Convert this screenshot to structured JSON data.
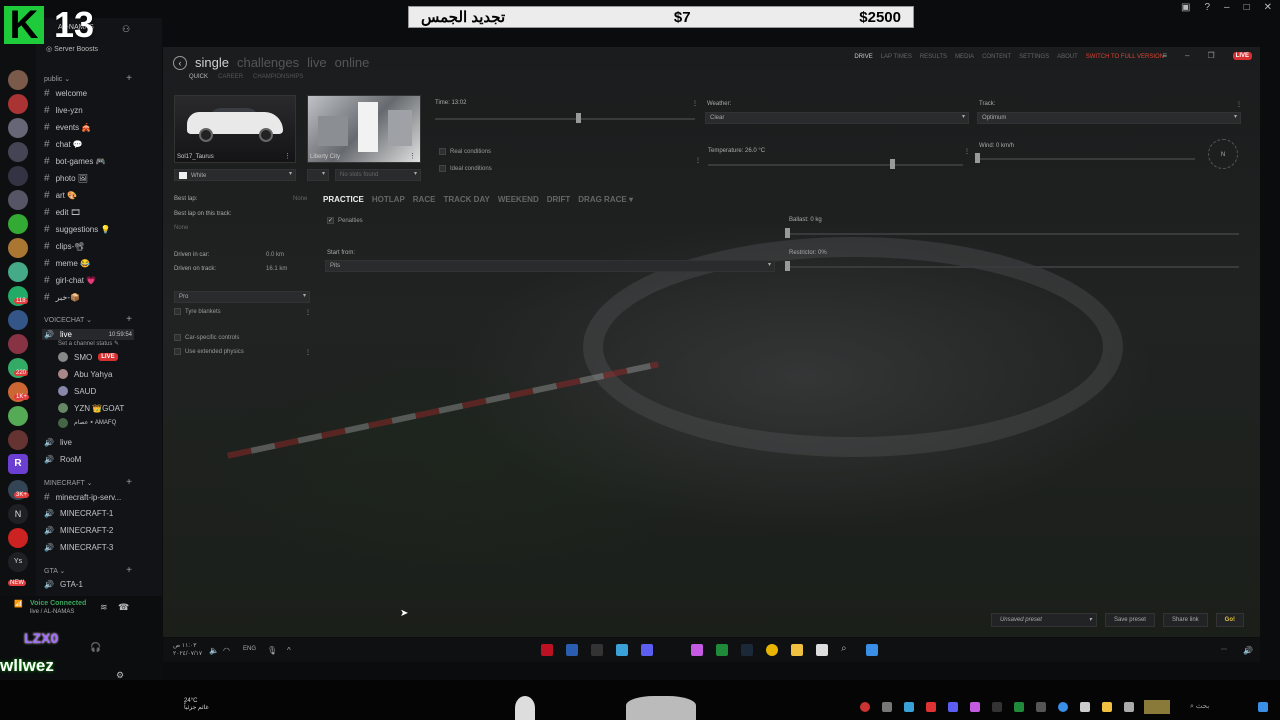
{
  "overlay": {
    "k_letter": "K",
    "number": "13",
    "banner": {
      "left": "تجديد الجمس",
      "mid": "$7",
      "right": "$2500"
    }
  },
  "discord": {
    "server_name": "AL-NAMAS",
    "server_boosts": "Server Boosts",
    "categories": {
      "public": "public",
      "voicechat": "VOICECHAT",
      "minecraft": "MINECRAFT",
      "gta": "GTA"
    },
    "text_channels": [
      "welcome",
      "live-yzn",
      "events 🎪",
      "chat 💬",
      "bot-games 🎮",
      "photo 🖼",
      "art 🎨",
      "edit 🎞",
      "suggestions 💡",
      "clips-📽",
      "meme 😂",
      "girl-chat 💗",
      "خبر-📦"
    ],
    "voice": {
      "live_channel": "live",
      "live_time": "10:59:54",
      "set_status": "Set a channel status ✎",
      "members": [
        {
          "name": "SMO",
          "badge": "LIVE"
        },
        {
          "name": "Abu Yahya",
          "badge": ""
        },
        {
          "name": "SAUD",
          "badge": ""
        },
        {
          "name": "YZN 👑GOAT",
          "badge": ""
        },
        {
          "name": "عصام ⭑ AMAFQ",
          "badge": ""
        }
      ],
      "other_channels": [
        "live",
        "RooM"
      ]
    },
    "minecraft_channels": [
      "minecraft-ip-serv...",
      "MINECRAFT-1",
      "MINECRAFT-2",
      "MINECRAFT-3"
    ],
    "gta_channels": [
      "GTA-1"
    ],
    "voice_connected": "Voice Connected",
    "voice_sub": "live / AL-NAMAS",
    "users": [
      "LZX0",
      "wllwez",
      "wllwez"
    ],
    "server_badges": [
      "118",
      "3K+",
      "220",
      "1K+",
      "NEW"
    ],
    "server_letters": [
      "R",
      "N",
      "Ys"
    ]
  },
  "game": {
    "modes": [
      "single",
      "challenges",
      "live",
      "online"
    ],
    "active_mode": "single",
    "sub_modes": [
      "QUICK",
      "CAREER",
      "CHAMPIONSHIPS"
    ],
    "top_nav": [
      "DRIVE",
      "LAP TIMES",
      "RESULTS",
      "MEDIA",
      "CONTENT",
      "SETTINGS",
      "ABOUT",
      "SWITCH TO FULL VERSION"
    ],
    "live_badge": "LIVE",
    "car_name": "Sol17_Taurus",
    "car_skin": "White",
    "track_name": "Liberty City",
    "track_layout": "No slots found",
    "time_label": "Time: 13:02",
    "time_level": 0.55,
    "weather_label": "Weather:",
    "weather_value": "Clear",
    "track_label": "Track:",
    "track_value": "Optimum",
    "real_conditions": "Real conditions",
    "ideal_conditions": "Ideal conditions",
    "temperature_label": "Temperature: 26.0 °C",
    "temperature_level": 0.72,
    "wind_label": "Wind: 0 km/h",
    "wind_dir": "N",
    "best_lap_label": "Best lap:",
    "best_lap_value": "None",
    "best_lap_track_label": "Best lap on this track:",
    "best_lap_track_value": "None",
    "driven_car_label": "Driven in car:",
    "driven_car_value": "0.0 km",
    "driven_track_label": "Driven on track:",
    "driven_track_value": "16.1 km",
    "race_types": [
      "PRACTICE",
      "HOTLAP",
      "RACE",
      "TRACK DAY",
      "WEEKEND",
      "DRIFT",
      "DRAG RACE ▾"
    ],
    "penalties": "Penalties",
    "start_from_label": "Start from:",
    "start_from_value": "Pits",
    "ballast_label": "Ballast: 0 kg",
    "restrictor_label": "Restrictor: 0%",
    "difficulty": "Pro",
    "tyre_blankets": "Tyre blankets",
    "car_specific": "Car-specific controls",
    "extended_physics": "Use extended physics",
    "preset": "Unsaved preset",
    "save_preset": "Save preset",
    "share_link": "Share link",
    "go": "Go!"
  },
  "inner_taskbar": {
    "time": "١١:٠٣ ص",
    "date": "٢٠٢٤/٠٧/١٧",
    "lang": "ENG"
  },
  "host_taskbar": {
    "weather": "24°C",
    "weather_sub": "غائم جزئياً",
    "search": "بحث"
  },
  "colors": {
    "discord_bg": "#121316",
    "accent_red": "#d63031",
    "go_yellow": "#e2c23a",
    "green_k": "#1ecb3a"
  }
}
